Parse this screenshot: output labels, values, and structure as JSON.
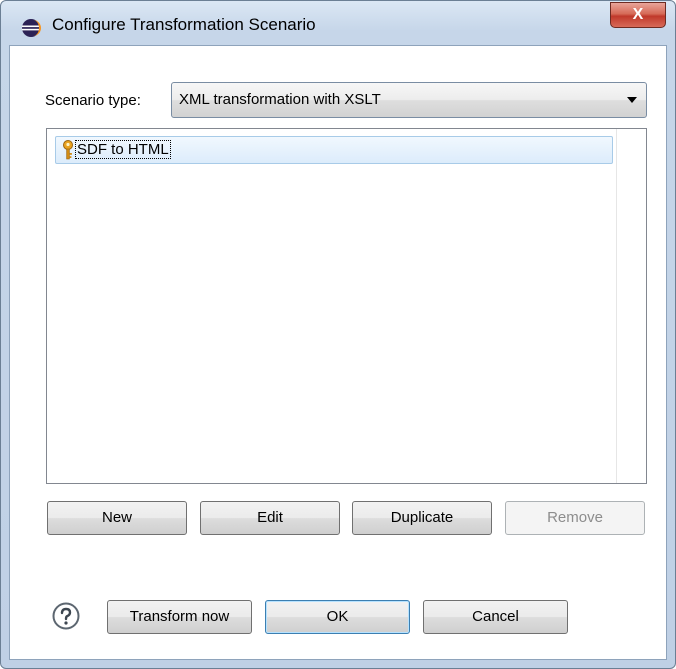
{
  "window": {
    "title": "Configure Transformation Scenario",
    "close_label": "X"
  },
  "scenario": {
    "label": "Scenario type:",
    "selected": "XML transformation with XSLT"
  },
  "list": {
    "items": [
      {
        "label": "SDF to HTML",
        "selected": true
      }
    ]
  },
  "list_buttons": {
    "new": "New",
    "edit": "Edit",
    "duplicate": "Duplicate",
    "remove": "Remove"
  },
  "dialog_buttons": {
    "transform_now": "Transform now",
    "ok": "OK",
    "cancel": "Cancel"
  },
  "colors": {
    "selection": "#dcecfb",
    "close_button": "#c0392b"
  }
}
